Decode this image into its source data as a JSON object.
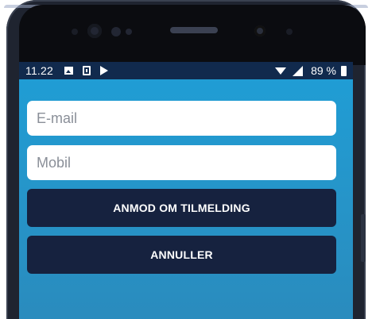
{
  "status_bar": {
    "time": "11.22",
    "icons": [
      "image-icon",
      "save-icon",
      "play-icon"
    ],
    "right_icons": [
      "wifi-icon",
      "signal-icon",
      "battery-icon"
    ],
    "battery": "89 %"
  },
  "form": {
    "email_placeholder": "E-mail",
    "mobile_placeholder": "Mobil",
    "request_label": "ANMOD OM TILMELDING",
    "cancel_label": "ANNULLER"
  },
  "colors": {
    "status_bar": "#112a4d",
    "screen_top": "#1f9ed6",
    "screen_bottom": "#2a8bbd",
    "button": "#16223f",
    "field": "#ffffff"
  }
}
